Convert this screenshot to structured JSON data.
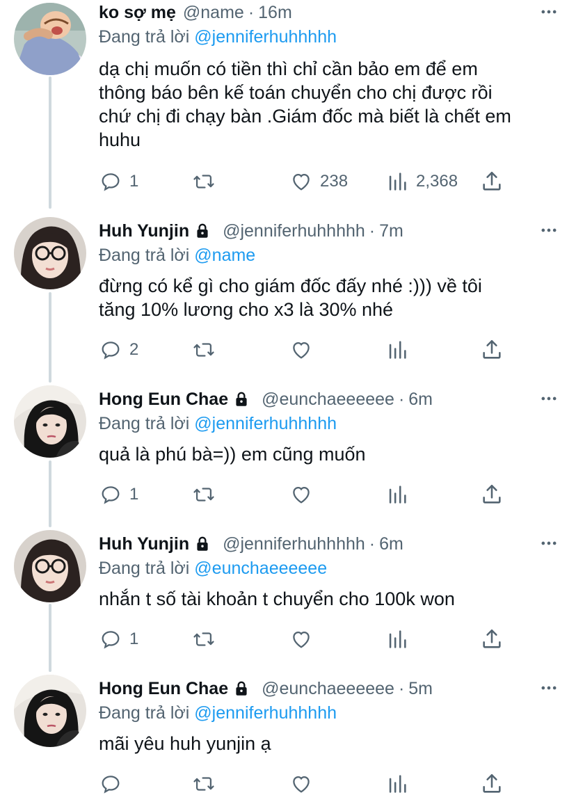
{
  "tweets": [
    {
      "name": "ko sợ mẹ",
      "handle": "@name",
      "time": "16m",
      "locked": false,
      "reply_prefix": "Đang trả lời",
      "reply_to": "@jenniferhuhhhhh",
      "lines": [
        "dạ chị muốn có tiền thì chỉ cần bảo em để em",
        "thông báo bên kế toán chuyển cho chị được rồi",
        "chứ chị đi chạy bàn .Giám đốc mà biết là chết em",
        "huhu"
      ],
      "replies": "1",
      "retweets": "",
      "likes": "238",
      "views": "2,368",
      "avatar_icon": "avatar-cartoon-crying"
    },
    {
      "name": "Huh Yunjin",
      "handle": "@jenniferhuhhhhh",
      "time": "7m",
      "locked": true,
      "reply_prefix": "Đang trả lời",
      "reply_to": "@name",
      "lines": [
        "đừng có kể gì cho giám đốc đấy nhé :))) về tôi",
        "tăng 10% lương cho x3 là 30% nhé"
      ],
      "replies": "2",
      "retweets": "",
      "likes": "",
      "views": "",
      "avatar_icon": "avatar-glasses-girl"
    },
    {
      "name": "Hong Eun Chae",
      "handle": "@eunchaeeeeee",
      "time": "6m",
      "locked": true,
      "reply_prefix": "Đang trả lời",
      "reply_to": "@jenniferhuhhhhh",
      "lines": [
        "quả là phú bà=)) em cũng muốn"
      ],
      "replies": "1",
      "retweets": "",
      "likes": "",
      "views": "",
      "avatar_icon": "avatar-girl-black-hair"
    },
    {
      "name": "Huh Yunjin",
      "handle": "@jenniferhuhhhhh",
      "time": "6m",
      "locked": true,
      "reply_prefix": "Đang trả lời",
      "reply_to": "@eunchaeeeeee",
      "lines": [
        "nhắn t số tài khoản t chuyển cho 100k won"
      ],
      "replies": "1",
      "retweets": "",
      "likes": "",
      "views": "",
      "avatar_icon": "avatar-glasses-girl"
    },
    {
      "name": "Hong Eun Chae",
      "handle": "@eunchaeeeeee",
      "time": "5m",
      "locked": true,
      "reply_prefix": "Đang trả lời",
      "reply_to": "@jenniferhuhhhhh",
      "lines": [
        "mãi yêu huh yunjin ạ"
      ],
      "replies": "",
      "retweets": "",
      "likes": "",
      "views": "",
      "avatar_icon": "avatar-girl-black-hair"
    }
  ],
  "colors": {
    "text": "#0f1419",
    "secondary": "#536471",
    "link": "#1d9bf0",
    "thread_line": "#cfd9de"
  }
}
